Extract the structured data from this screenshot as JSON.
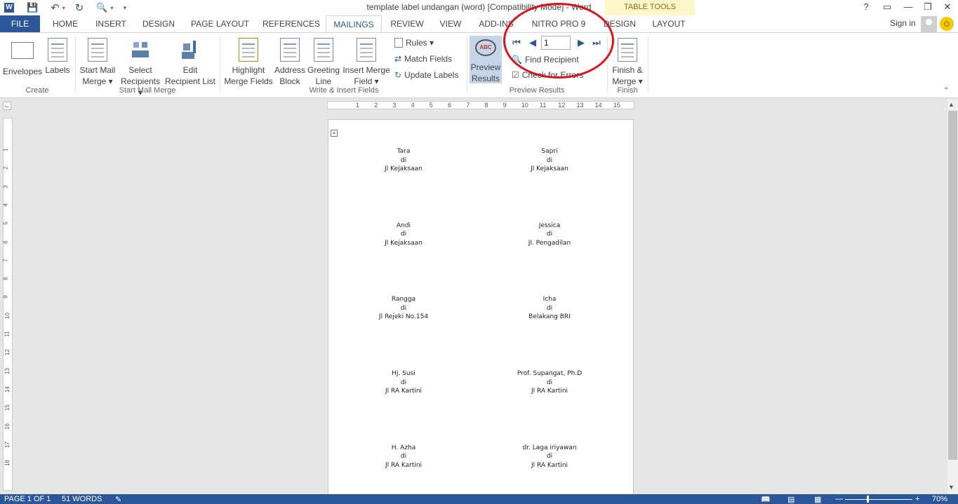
{
  "window": {
    "title": "template label undangan (word) [Compatibility Mode] - Word",
    "help": "?",
    "minimize": "—",
    "restore": "❐",
    "close": "✕"
  },
  "table_tools": {
    "label": "TABLE TOOLS"
  },
  "tabs": [
    {
      "label": "FILE"
    },
    {
      "label": "HOME"
    },
    {
      "label": "INSERT"
    },
    {
      "label": "DESIGN"
    },
    {
      "label": "PAGE LAYOUT"
    },
    {
      "label": "REFERENCES"
    },
    {
      "label": "MAILINGS"
    },
    {
      "label": "REVIEW"
    },
    {
      "label": "VIEW"
    },
    {
      "label": "ADD-INS"
    },
    {
      "label": "NITRO PRO 9"
    },
    {
      "label": "DESIGN"
    },
    {
      "label": "LAYOUT"
    }
  ],
  "account": {
    "sign_in": "Sign in"
  },
  "ribbon": {
    "create": {
      "label": "Create",
      "envelopes": "Envelopes",
      "labels": "Labels"
    },
    "start_mail_merge": {
      "label": "Start Mail Merge",
      "start_l1": "Start Mail",
      "start_l2": "Merge ▾",
      "select_l1": "Select",
      "select_l2": "Recipients ▾",
      "edit_l1": "Edit",
      "edit_l2": "Recipient List"
    },
    "write_insert": {
      "label": "Write & Insert Fields",
      "highlight_l1": "Highlight",
      "highlight_l2": "Merge Fields",
      "address_l1": "Address",
      "address_l2": "Block",
      "greeting_l1": "Greeting",
      "greeting_l2": "Line",
      "insert_l1": "Insert Merge",
      "insert_l2": "Field ▾",
      "rules": "Rules ▾",
      "match_fields": "Match Fields",
      "update_labels": "Update Labels"
    },
    "preview_results": {
      "label": "Preview Results",
      "preview_l1": "Preview",
      "preview_l2": "Results",
      "record_value": "1",
      "find_recipient": "Find Recipient",
      "check_errors": "Check for Errors"
    },
    "finish": {
      "label": "Finish",
      "finish_l1": "Finish &",
      "finish_l2": "Merge ▾"
    }
  },
  "ruler": {
    "h_ticks": [
      "1",
      "2",
      "3",
      "4",
      "5",
      "6",
      "7",
      "8",
      "9",
      "10",
      "11",
      "12",
      "13",
      "14",
      "15"
    ],
    "v_ticks": [
      "1",
      "2",
      "3",
      "4",
      "5",
      "6",
      "7",
      "8",
      "9",
      "10",
      "11",
      "12",
      "13",
      "14",
      "15",
      "16",
      "17",
      "18"
    ]
  },
  "labels": [
    {
      "name": "Tara",
      "di": "di",
      "address": "Jl Kejaksaan"
    },
    {
      "name": "Sapri",
      "di": "di",
      "address": "Jl Kejaksaan"
    },
    {
      "name": "Andi",
      "di": "di",
      "address": "Jl Kejaksaan"
    },
    {
      "name": "Jessica",
      "di": "di",
      "address": "Jl. Pengadilan"
    },
    {
      "name": "Rangga",
      "di": "di",
      "address": "Jl Rejeki No.154"
    },
    {
      "name": "Icha",
      "di": "di",
      "address": "Belakang BRI"
    },
    {
      "name": "Hj. Susi",
      "di": "di",
      "address": "Jl RA Kartini"
    },
    {
      "name": "Prof. Supangat, Ph.D",
      "di": "di",
      "address": "Jl RA Kartini"
    },
    {
      "name": "H. Azha",
      "di": "di",
      "address": "Jl RA Kartini"
    },
    {
      "name": "dr. Laga iriyawan",
      "di": "di",
      "address": "Jl RA Kartini"
    }
  ],
  "status": {
    "page": "PAGE 1 OF 1",
    "words": "51 WORDS",
    "zoom": "70%"
  },
  "colors": {
    "accent": "#2b579a",
    "highlight_circle": "#d9141c"
  }
}
